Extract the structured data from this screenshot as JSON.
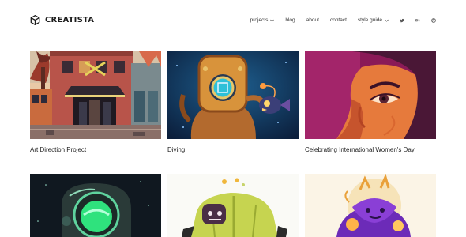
{
  "brand": {
    "name": "CREATISTA"
  },
  "nav": {
    "projects": "projects",
    "blog": "blog",
    "about": "about",
    "contact": "contact",
    "style_guide": "style guide"
  },
  "social": {
    "icons": [
      "twitter-icon",
      "behance-icon",
      "dribbble-icon"
    ]
  },
  "portfolio": {
    "items": [
      {
        "title": "Art Direction Project"
      },
      {
        "title": "Diving"
      },
      {
        "title": "Celebrating International Women's Day"
      },
      {
        "title": ""
      },
      {
        "title": ""
      },
      {
        "title": ""
      }
    ]
  }
}
